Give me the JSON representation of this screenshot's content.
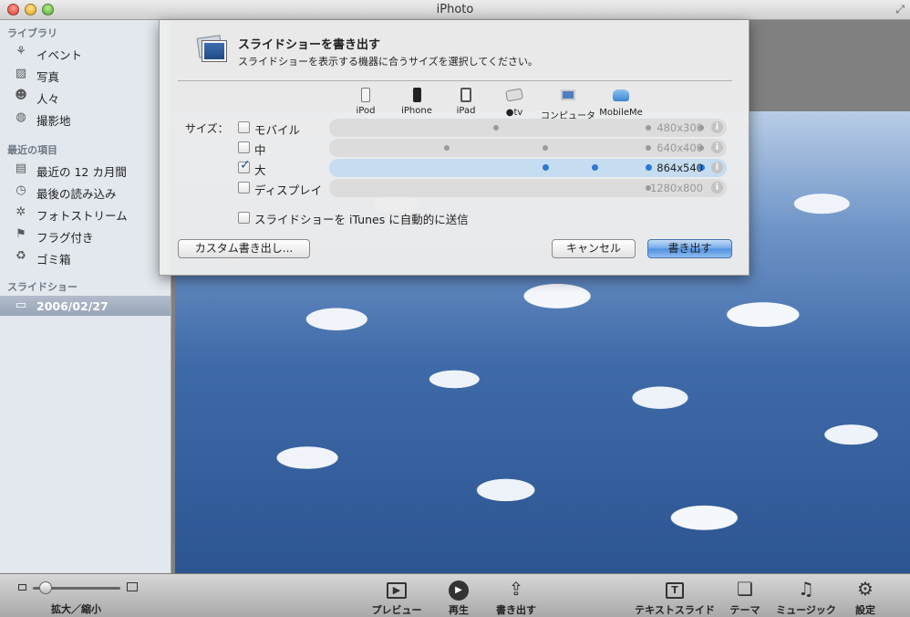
{
  "window": {
    "title": "iPhoto"
  },
  "sidebar": {
    "library_header": "ライブラリ",
    "library_items": [
      {
        "label": "イベント",
        "icon": "⚘"
      },
      {
        "label": "写真",
        "icon": "▨"
      },
      {
        "label": "人々",
        "icon": "☻"
      },
      {
        "label": "撮影地",
        "icon": "◍"
      }
    ],
    "recent_header": "最近の項目",
    "recent_items": [
      {
        "label": "最近の 12 カ月間",
        "icon": "▤"
      },
      {
        "label": "最後の読み込み",
        "icon": "◷"
      },
      {
        "label": "フォトストリーム",
        "icon": "✲"
      },
      {
        "label": "フラグ付き",
        "icon": "⚑"
      },
      {
        "label": "ゴミ箱",
        "icon": "♻"
      }
    ],
    "slideshow_header": "スライドショー",
    "slideshow_items": [
      {
        "label": "2006/02/27",
        "icon": "▭",
        "selected": true
      }
    ]
  },
  "dialog": {
    "title": "スライドショーを書き出す",
    "subtitle": "スライドショーを表示する機器に合うサイズを選択してください。",
    "devices": [
      "iPod",
      "iPhone",
      "iPad",
      "tv",
      "コンピュータ",
      "MobileMe"
    ],
    "size_label": "サイズ：",
    "sizes": [
      {
        "name": "モバイル",
        "resolution": "480x300",
        "checked": false,
        "dots": [
          false,
          true,
          false,
          false,
          true,
          true
        ]
      },
      {
        "name": "中",
        "resolution": "640x400",
        "checked": false,
        "dots": [
          true,
          false,
          true,
          false,
          true,
          true
        ]
      },
      {
        "name": "大",
        "resolution": "864x540",
        "checked": true,
        "dots": [
          false,
          false,
          true,
          true,
          true,
          true
        ]
      },
      {
        "name": "ディスプレイ",
        "resolution": "1280x800",
        "checked": false,
        "dots": [
          false,
          false,
          false,
          false,
          true,
          false
        ]
      }
    ],
    "auto_send_label": "スライドショーを iTunes に自動的に送信",
    "custom_export_label": "カスタム書き出し...",
    "cancel_label": "キャンセル",
    "export_label": "書き出す"
  },
  "toolbar": {
    "zoom_label": "拡大／縮小",
    "zoom_level": 0.15,
    "buttons": [
      {
        "label": "プレビュー",
        "icon": "▶"
      },
      {
        "label": "再生",
        "icon": "▶"
      },
      {
        "label": "書き出す",
        "icon": "⇪"
      },
      {
        "label": "テキストスライド",
        "icon": "T"
      },
      {
        "label": "テーマ",
        "icon": "❏"
      },
      {
        "label": "ミュージック",
        "icon": "♫"
      },
      {
        "label": "設定",
        "icon": "⚙"
      }
    ]
  },
  "colors": {
    "selected_dot": "#2b78d6",
    "highlight_row": "#c6dcf0",
    "primary_button": "#4f90e0"
  }
}
